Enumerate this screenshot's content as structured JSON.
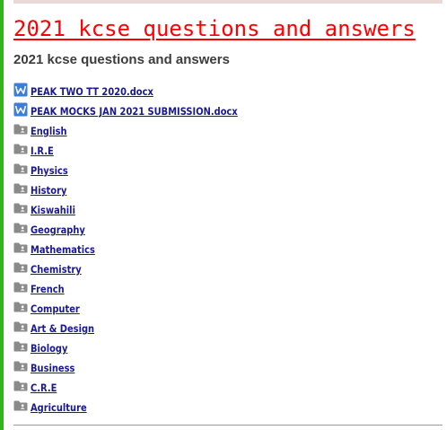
{
  "page": {
    "title": "2021 kcse questions and answers",
    "subtitle": "2021 kcse questions and answers"
  },
  "colors": {
    "accent_bar": "#37b21f",
    "title": "#ff0000",
    "link": "#1a1a8c",
    "word_icon": "#3b7dd8",
    "folder_icon": "#8a8a8a"
  },
  "files": [
    {
      "name": "PEAK TWO TT 2020.docx",
      "icon": "word-doc-icon",
      "kind": "doc"
    },
    {
      "name": "PEAK MOCKS JAN 2021 SUBMISSION.docx",
      "icon": "word-doc-icon",
      "kind": "doc"
    },
    {
      "name": "English",
      "icon": "shared-folder-icon",
      "kind": "folder"
    },
    {
      "name": "I.R.E",
      "icon": "shared-folder-icon",
      "kind": "folder"
    },
    {
      "name": "Physics",
      "icon": "shared-folder-icon",
      "kind": "folder"
    },
    {
      "name": "History",
      "icon": "shared-folder-icon",
      "kind": "folder"
    },
    {
      "name": "Kiswahili",
      "icon": "shared-folder-icon",
      "kind": "folder"
    },
    {
      "name": "Geography",
      "icon": "shared-folder-icon",
      "kind": "folder"
    },
    {
      "name": "Mathematics",
      "icon": "shared-folder-icon",
      "kind": "folder"
    },
    {
      "name": "Chemistry",
      "icon": "shared-folder-icon",
      "kind": "folder"
    },
    {
      "name": "French",
      "icon": "shared-folder-icon",
      "kind": "folder"
    },
    {
      "name": "Computer",
      "icon": "shared-folder-icon",
      "kind": "folder"
    },
    {
      "name": "Art & Design",
      "icon": "shared-folder-icon",
      "kind": "folder"
    },
    {
      "name": "Biology",
      "icon": "shared-folder-icon",
      "kind": "folder"
    },
    {
      "name": "Business",
      "icon": "shared-folder-icon",
      "kind": "folder"
    },
    {
      "name": "C.R.E",
      "icon": "shared-folder-icon",
      "kind": "folder"
    },
    {
      "name": "Agriculture",
      "icon": "shared-folder-icon",
      "kind": "folder"
    }
  ]
}
